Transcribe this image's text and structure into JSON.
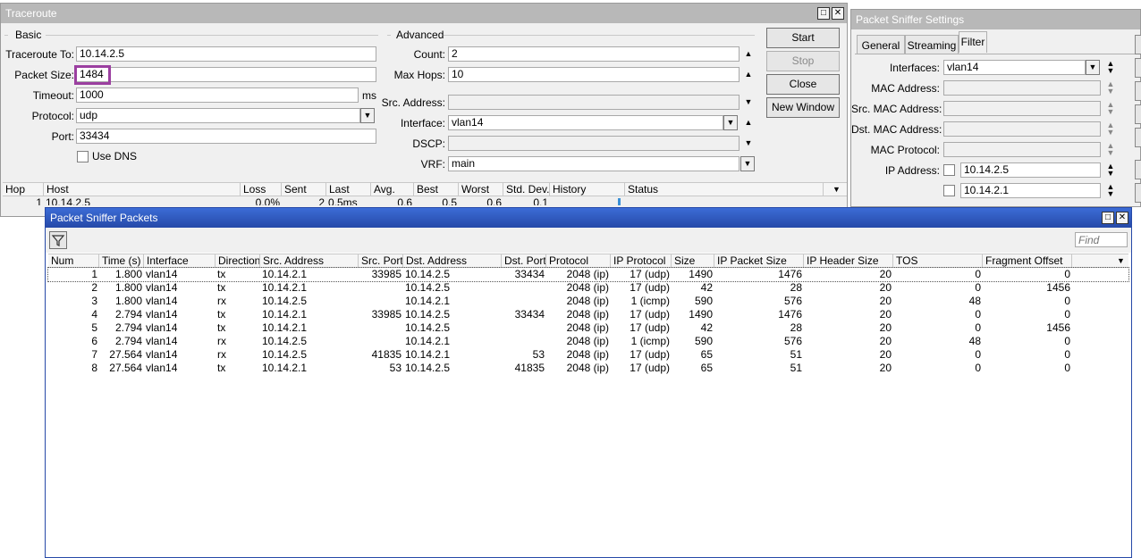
{
  "traceroute": {
    "title": "Traceroute",
    "basic_group": "Basic",
    "advanced_group": "Advanced",
    "fields": {
      "to_label": "Traceroute To:",
      "to_value": "10.14.2.5",
      "size_label": "Packet Size:",
      "size_value": "1484",
      "timeout_label": "Timeout:",
      "timeout_value": "1000",
      "timeout_unit": "ms",
      "protocol_label": "Protocol:",
      "protocol_value": "udp",
      "port_label": "Port:",
      "port_value": "33434",
      "dns_label": "Use DNS",
      "count_label": "Count:",
      "count_value": "2",
      "hops_label": "Max Hops:",
      "hops_value": "10",
      "src_label": "Src. Address:",
      "src_value": "",
      "iface_label": "Interface:",
      "iface_value": "vlan14",
      "dscp_label": "DSCP:",
      "dscp_value": "",
      "vrf_label": "VRF:",
      "vrf_value": "main"
    },
    "buttons": {
      "start": "Start",
      "stop": "Stop",
      "close": "Close",
      "new_window": "New Window"
    },
    "columns": [
      "Hop",
      "Host",
      "Loss",
      "Sent",
      "Last",
      "Avg.",
      "Best",
      "Worst",
      "Std. Dev.",
      "History",
      "Status"
    ],
    "row": [
      "1",
      "10.14.2.5",
      "0.0%",
      "2",
      "0.5ms",
      "0.6",
      "0.5",
      "0.6",
      "0.1",
      "",
      ""
    ],
    "highlight_color": "#9b3fa0"
  },
  "sniffer_settings": {
    "title": "Packet Sniffer Settings",
    "tabs": [
      "General",
      "Streaming",
      "Filter"
    ],
    "fields": {
      "interfaces_label": "Interfaces:",
      "interfaces_value": "vlan14",
      "mac_label": "MAC Address:",
      "src_mac_label": "Src. MAC Address:",
      "dst_mac_label": "Dst. MAC Address:",
      "mac_proto_label": "MAC Protocol:",
      "ip_label": "IP Address:",
      "ip_value_1": "10.14.2.5",
      "ip_value_2": "10.14.2.1"
    }
  },
  "packets": {
    "title": "Packet Sniffer Packets",
    "find_placeholder": "Find",
    "columns": [
      "Num",
      "Time (s)",
      "Interface",
      "Direction",
      "Src. Address",
      "Src. Port",
      "Dst. Address",
      "Dst. Port",
      "Protocol",
      "IP Protocol",
      "Size",
      "IP Packet Size",
      "IP Header Size",
      "TOS",
      "Fragment Offset"
    ],
    "rows": [
      [
        "1",
        "1.800",
        "vlan14",
        "tx",
        "10.14.2.1",
        "33985",
        "10.14.2.5",
        "33434",
        "2048 (ip)",
        "17 (udp)",
        "1490",
        "1476",
        "20",
        "0",
        "0"
      ],
      [
        "2",
        "1.800",
        "vlan14",
        "tx",
        "10.14.2.1",
        "",
        "10.14.2.5",
        "",
        "2048 (ip)",
        "17 (udp)",
        "42",
        "28",
        "20",
        "0",
        "1456"
      ],
      [
        "3",
        "1.800",
        "vlan14",
        "rx",
        "10.14.2.5",
        "",
        "10.14.2.1",
        "",
        "2048 (ip)",
        "1 (icmp)",
        "590",
        "576",
        "20",
        "48",
        "0"
      ],
      [
        "4",
        "2.794",
        "vlan14",
        "tx",
        "10.14.2.1",
        "33985",
        "10.14.2.5",
        "33434",
        "2048 (ip)",
        "17 (udp)",
        "1490",
        "1476",
        "20",
        "0",
        "0"
      ],
      [
        "5",
        "2.794",
        "vlan14",
        "tx",
        "10.14.2.1",
        "",
        "10.14.2.5",
        "",
        "2048 (ip)",
        "17 (udp)",
        "42",
        "28",
        "20",
        "0",
        "1456"
      ],
      [
        "6",
        "2.794",
        "vlan14",
        "rx",
        "10.14.2.5",
        "",
        "10.14.2.1",
        "",
        "2048 (ip)",
        "1 (icmp)",
        "590",
        "576",
        "20",
        "48",
        "0"
      ],
      [
        "7",
        "27.564",
        "vlan14",
        "rx",
        "10.14.2.5",
        "41835",
        "10.14.2.1",
        "53",
        "2048 (ip)",
        "17 (udp)",
        "65",
        "51",
        "20",
        "0",
        "0"
      ],
      [
        "8",
        "27.564",
        "vlan14",
        "tx",
        "10.14.2.1",
        "53",
        "10.14.2.5",
        "41835",
        "2048 (ip)",
        "17 (udp)",
        "65",
        "51",
        "20",
        "0",
        "0"
      ]
    ]
  }
}
